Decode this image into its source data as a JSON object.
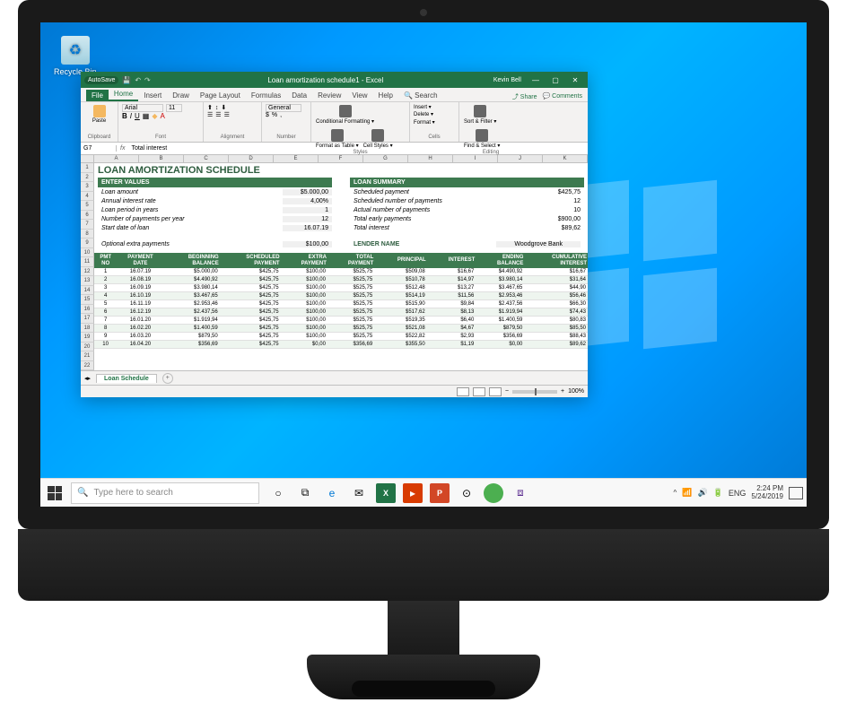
{
  "desktop": {
    "recyclebin": "Recycle Bin"
  },
  "excel": {
    "titlebar": {
      "autosave": "AutoSave",
      "filename": "Loan amortization schedule1 - Excel",
      "user": "Kevin Bell"
    },
    "tabs": {
      "file": "File",
      "home": "Home",
      "insert": "Insert",
      "draw": "Draw",
      "pagelayout": "Page Layout",
      "formulas": "Formulas",
      "data": "Data",
      "review": "Review",
      "view": "View",
      "help": "Help",
      "search": "🔍 Search",
      "share": "⤴ Share",
      "comments": "💬 Comments"
    },
    "ribbon": {
      "clipboard": {
        "name": "Clipboard",
        "paste": "Paste"
      },
      "font": {
        "name": "Font",
        "family": "Arial",
        "size": "11"
      },
      "alignment": {
        "name": "Alignment"
      },
      "number": {
        "name": "Number",
        "format": "General"
      },
      "styles": {
        "name": "Styles",
        "cf": "Conditional Formatting ▾",
        "ft": "Format as Table ▾",
        "cs": "Cell Styles ▾"
      },
      "cells": {
        "name": "Cells",
        "ins": "Insert ▾",
        "del": "Delete ▾",
        "fmt": "Format ▾"
      },
      "editing": {
        "name": "Editing",
        "sort": "Sort & Filter ▾",
        "find": "Find & Select ▾"
      }
    },
    "formulabar": {
      "cell": "G7",
      "content": "Total interest"
    },
    "cols": [
      "A",
      "B",
      "C",
      "D",
      "E",
      "F",
      "G",
      "H",
      "I",
      "J",
      "K"
    ],
    "rows": [
      "1",
      "2",
      "3",
      "4",
      "5",
      "6",
      "7",
      "8",
      "9",
      "10",
      "11",
      "12",
      "13",
      "14",
      "15",
      "16",
      "17",
      "18",
      "19",
      "20",
      "21",
      "22"
    ],
    "sheet": {
      "title": "LOAN AMORTIZATION SCHEDULE",
      "entervalues": {
        "head": "ENTER VALUES",
        "items": [
          {
            "lbl": "Loan amount",
            "val": "$5.000,00"
          },
          {
            "lbl": "Annual interest rate",
            "val": "4,00%"
          },
          {
            "lbl": "Loan period in years",
            "val": "1"
          },
          {
            "lbl": "Number of payments per year",
            "val": "12"
          },
          {
            "lbl": "Start date of loan",
            "val": "16.07.19"
          }
        ],
        "extra": {
          "lbl": "Optional extra payments",
          "val": "$100,00"
        }
      },
      "loansummary": {
        "head": "LOAN SUMMARY",
        "items": [
          {
            "lbl": "Scheduled payment",
            "val": "$425,75"
          },
          {
            "lbl": "Scheduled number of payments",
            "val": "12"
          },
          {
            "lbl": "Actual number of payments",
            "val": "10"
          },
          {
            "lbl": "Total early payments",
            "val": "$900,00"
          },
          {
            "lbl": "Total interest",
            "val": "$89,62"
          }
        ]
      },
      "lender": {
        "lbl": "LENDER NAME",
        "val": "Woodgrove Bank"
      },
      "table": {
        "headers": [
          "PMT NO",
          "PAYMENT DATE",
          "BEGINNING BALANCE",
          "SCHEDULED PAYMENT",
          "EXTRA PAYMENT",
          "TOTAL PAYMENT",
          "PRINCIPAL",
          "INTEREST",
          "ENDING BALANCE",
          "CUMULATIVE INTEREST"
        ],
        "rows": [
          [
            "1",
            "16.07.19",
            "$5.000,00",
            "$425,75",
            "$100,00",
            "$525,75",
            "$509,08",
            "$16,67",
            "$4.490,92",
            "$16,67"
          ],
          [
            "2",
            "16.08.19",
            "$4.490,92",
            "$425,75",
            "$100,00",
            "$525,75",
            "$510,78",
            "$14,97",
            "$3.980,14",
            "$31,64"
          ],
          [
            "3",
            "16.09.19",
            "$3.980,14",
            "$425,75",
            "$100,00",
            "$525,75",
            "$512,48",
            "$13,27",
            "$3.467,65",
            "$44,90"
          ],
          [
            "4",
            "16.10.19",
            "$3.467,65",
            "$425,75",
            "$100,00",
            "$525,75",
            "$514,19",
            "$11,56",
            "$2.953,46",
            "$56,46"
          ],
          [
            "5",
            "16.11.19",
            "$2.953,46",
            "$425,75",
            "$100,00",
            "$525,75",
            "$515,90",
            "$9,84",
            "$2.437,56",
            "$66,30"
          ],
          [
            "6",
            "16.12.19",
            "$2.437,56",
            "$425,75",
            "$100,00",
            "$525,75",
            "$517,62",
            "$8,13",
            "$1.919,94",
            "$74,43"
          ],
          [
            "7",
            "16.01.20",
            "$1.919,94",
            "$425,75",
            "$100,00",
            "$525,75",
            "$519,35",
            "$6,40",
            "$1.400,59",
            "$80,83"
          ],
          [
            "8",
            "16.02.20",
            "$1.400,59",
            "$425,75",
            "$100,00",
            "$525,75",
            "$521,08",
            "$4,67",
            "$879,50",
            "$85,50"
          ],
          [
            "9",
            "16.03.20",
            "$879,50",
            "$425,75",
            "$100,00",
            "$525,75",
            "$522,82",
            "$2,93",
            "$356,69",
            "$88,43"
          ],
          [
            "10",
            "16.04.20",
            "$356,69",
            "$425,75",
            "$0,00",
            "$356,69",
            "$355,50",
            "$1,19",
            "$0,00",
            "$89,62"
          ]
        ]
      },
      "tabname": "Loan Schedule",
      "zoom": "100%"
    }
  },
  "taskbar": {
    "search": "Type here to search",
    "lang": "ENG",
    "time": "2:24 PM",
    "date": "5/24/2019"
  }
}
